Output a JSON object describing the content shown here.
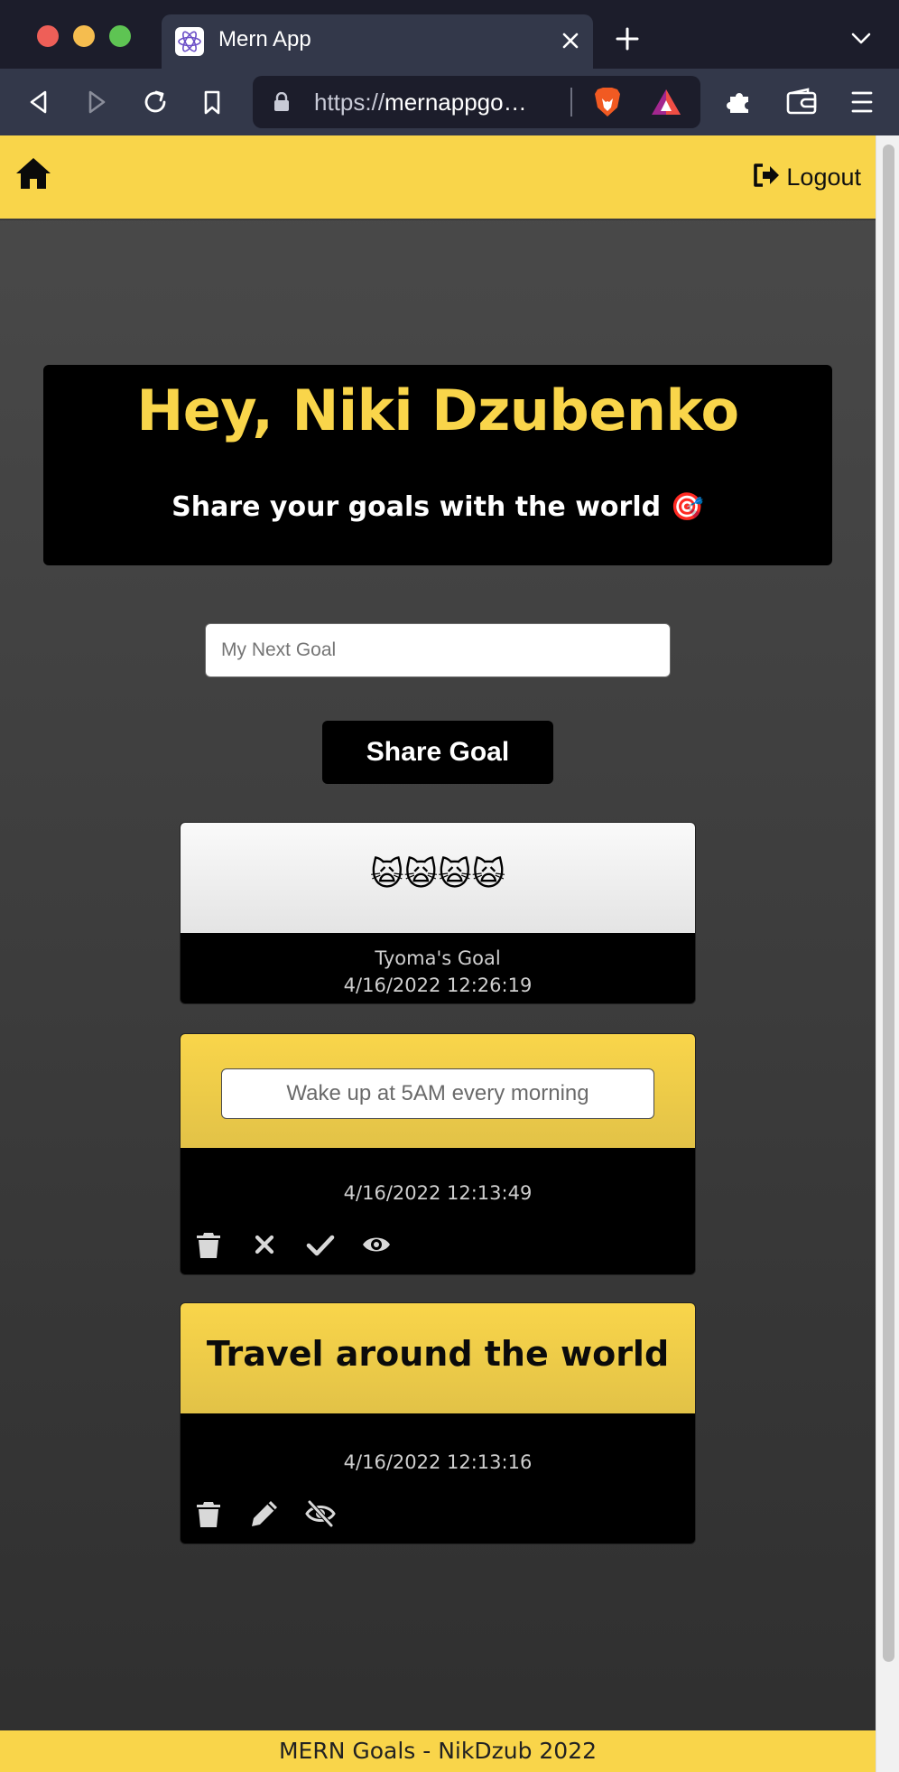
{
  "browser": {
    "tab_title": "Mern App",
    "url_scheme": "https://",
    "url_host": "mernappgo…"
  },
  "header": {
    "home_icon": "home-icon",
    "logout_icon": "sign-out-icon",
    "logout_label": "Logout"
  },
  "hero": {
    "title": "Hey, Niki Dzubenko",
    "subtitle": "Share your goals with the world 🎯"
  },
  "goal_form": {
    "placeholder": "My Next Goal",
    "value": "",
    "submit_label": "Share Goal"
  },
  "goals": [
    {
      "text": "🙀🙀🙀🙀",
      "owner": "Tyoma's Goal",
      "date": "4/16/2022 12:26:19"
    },
    {
      "edit_placeholder": "Wake up at 5AM every morning",
      "date": "4/16/2022 12:13:49",
      "actions": [
        "trash-icon",
        "cancel-icon",
        "check-icon",
        "eye-icon"
      ]
    },
    {
      "text": "Travel around the world",
      "date": "4/16/2022 12:13:16",
      "actions": [
        "trash-icon",
        "pencil-icon",
        "eye-slash-icon"
      ]
    }
  ],
  "footer": {
    "text": "MERN Goals - NikDzub 2022"
  },
  "colors": {
    "accent": "#f9d54a",
    "card_bg": "#000000",
    "page_bg_top": "#4a4a4a",
    "page_bg_bottom": "#2f2f2f"
  }
}
